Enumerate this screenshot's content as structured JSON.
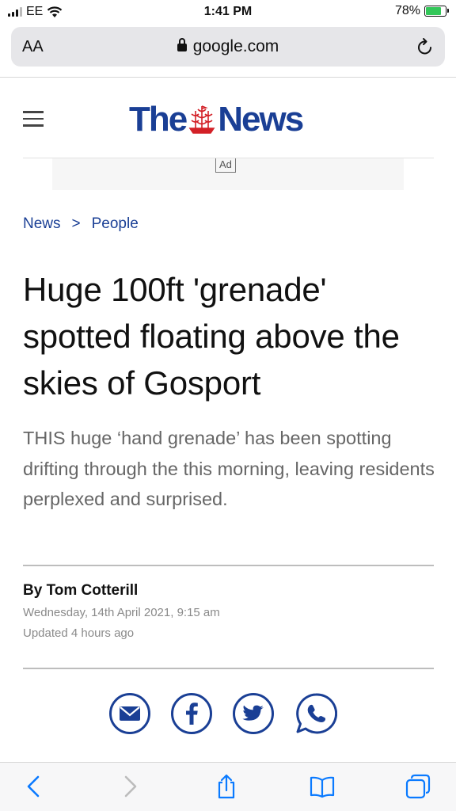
{
  "status_bar": {
    "carrier": "EE",
    "time": "1:41 PM",
    "battery": "78%",
    "battery_level": 0.78,
    "icons": [
      "signal-icon",
      "wifi-icon",
      "battery-charging-icon"
    ]
  },
  "browser": {
    "text_size_label": "AA",
    "url": "google.com",
    "icons": [
      "lock-icon",
      "reload-icon"
    ]
  },
  "site": {
    "logo_left": "The",
    "logo_right": "News",
    "logo_color": "#1a3f95",
    "ad_label": "Ad"
  },
  "breadcrumb": {
    "items": [
      "News",
      "People"
    ],
    "separator": ">"
  },
  "article": {
    "headline": "Huge 100ft 'grenade' spotted floating above the skies of Gosport",
    "standfirst": "THIS huge ‘hand grenade’ has been spotting drifting through the this morning, leaving residents perplexed and surprised.",
    "byline": "By Tom Cotterill",
    "date": "Wednesday, 14th April 2021, 9:15 am",
    "updated": "Updated  4 hours ago"
  },
  "share": {
    "icons": [
      "email-icon",
      "facebook-icon",
      "twitter-icon",
      "whatsapp-icon"
    ],
    "color": "#1a3f95"
  },
  "toolbar": {
    "icons": [
      "back-icon",
      "forward-icon",
      "share-icon",
      "bookmarks-icon",
      "tabs-icon"
    ],
    "accent": "#0a7aff"
  }
}
